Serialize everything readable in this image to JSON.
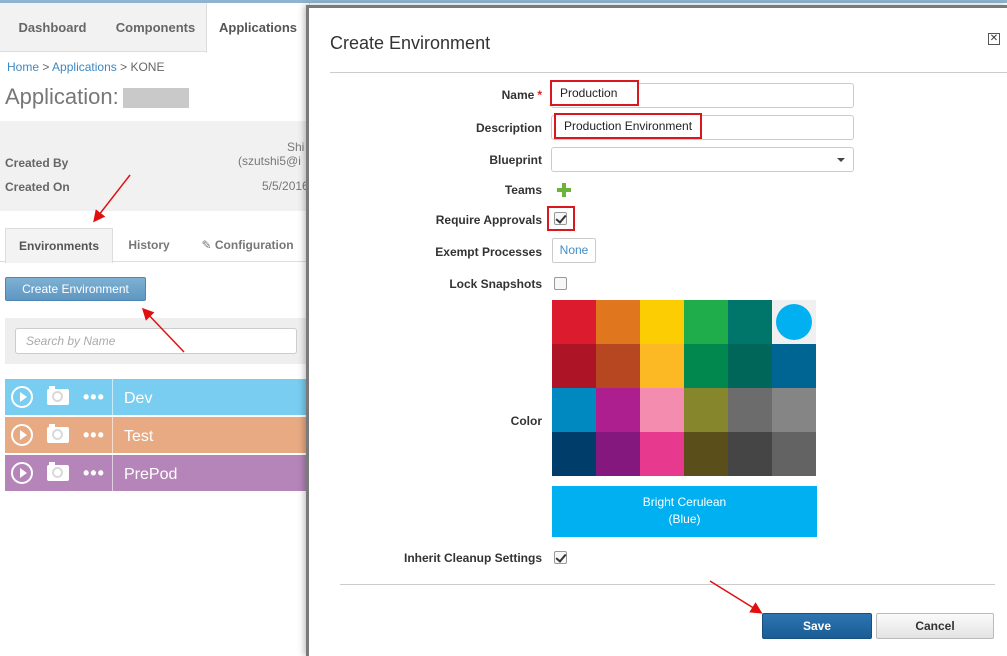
{
  "nav": {
    "tabs": [
      "Dashboard",
      "Components",
      "Applications"
    ],
    "active_tab": "Applications"
  },
  "breadcrumb": {
    "home": "Home",
    "sep": ">",
    "applications": "Applications",
    "current": "KONE"
  },
  "page": {
    "title_prefix": "Application:",
    "created_by_label": "Created By",
    "created_by_value_top": "Shi",
    "created_by_value": "(szutshi5@i",
    "created_on_label": "Created On",
    "created_on_value": "5/5/2016"
  },
  "subtabs": {
    "environments": "Environments",
    "history": "History",
    "configuration": "Configuration"
  },
  "create_environment_button": "Create Environment",
  "search": {
    "placeholder": "Search by Name"
  },
  "environments": [
    {
      "name": "Dev",
      "color": "#79cdf0"
    },
    {
      "name": "Test",
      "color": "#e8aa82"
    },
    {
      "name": "PrePod",
      "color": "#b584b9"
    }
  ],
  "modal": {
    "title": "Create Environment",
    "close_icon": "close-icon",
    "fields": {
      "name_label": "Name",
      "required_mark": "*",
      "name_value": "Production",
      "description_label": "Description",
      "description_value": "Production Environment",
      "blueprint_label": "Blueprint",
      "blueprint_value": "",
      "teams_label": "Teams",
      "require_approvals_label": "Require Approvals",
      "require_approvals_checked": true,
      "exempt_processes_label": "Exempt Processes",
      "exempt_processes_value": "None",
      "lock_snapshots_label": "Lock Snapshots",
      "lock_snapshots_checked": false,
      "color_label": "Color",
      "inherit_cleanup_label": "Inherit Cleanup Settings",
      "inherit_cleanup_checked": true
    },
    "swatches": [
      [
        "#dc1c2e",
        "#e0761e",
        "#fdcd04",
        "#1fad4c",
        "#00766b",
        "#00b0f0"
      ],
      [
        "#ad1526",
        "#b74721",
        "#fdb924",
        "#00884f",
        "#00665a",
        "#006593"
      ],
      [
        "#0088c0",
        "#ad1f8e",
        "#f48cb0",
        "#86862c",
        "#6c6c6c",
        "#858585"
      ],
      [
        "#003d6b",
        "#84187f",
        "#e73a8e",
        "#5a4e1a",
        "#454545",
        "#636363"
      ]
    ],
    "selected_swatch": "#00b0f0",
    "selected_color_name": "Bright Cerulean",
    "selected_color_group": "(Blue)",
    "save_label": "Save",
    "cancel_label": "Cancel"
  },
  "colors": {
    "highlight": "#d8181e",
    "primary": "#1a5d96",
    "link": "#3d88c3"
  }
}
